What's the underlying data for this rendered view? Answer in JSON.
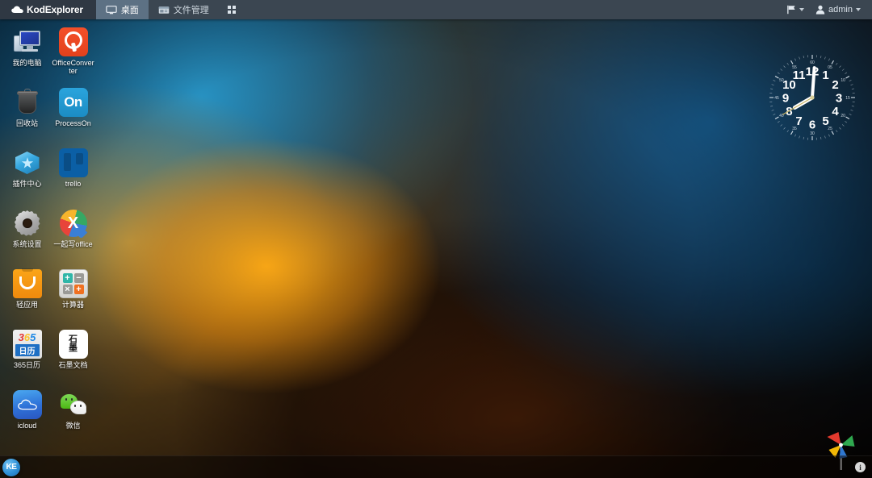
{
  "app": {
    "title": "KodExplorer",
    "logo_icon": "cloud-icon"
  },
  "topbar": {
    "tabs": [
      {
        "label": "桌面",
        "icon": "monitor-icon",
        "active": true
      },
      {
        "label": "文件管理",
        "icon": "folder-window-icon",
        "active": false
      }
    ],
    "grid_icon": "app-grid-icon",
    "right": {
      "flag_icon": "flag-icon",
      "flag_caret": "chevron-down-icon",
      "user_icon": "user-icon",
      "user_label": "admin",
      "user_caret": "chevron-down-icon"
    }
  },
  "desktop": {
    "icons": [
      {
        "label": "我的电脑",
        "art": "mypc",
        "icon": "my-computer-icon"
      },
      {
        "label": "OfficeConverter",
        "art": "officeconv",
        "icon": "officeconverter-icon"
      },
      {
        "label": "回收站",
        "art": "trash",
        "icon": "recycle-bin-icon"
      },
      {
        "label": "ProcessOn",
        "art": "processon",
        "icon": "processon-icon",
        "art_text": "On"
      },
      {
        "label": "插件中心",
        "art": "plugin",
        "icon": "plugin-center-icon"
      },
      {
        "label": "trello",
        "art": "trello",
        "icon": "trello-icon"
      },
      {
        "label": "系统设置",
        "art": "gear",
        "icon": "system-settings-icon"
      },
      {
        "label": "一起写office",
        "art": "yqx",
        "icon": "yiqixie-office-icon",
        "art_text": "X"
      },
      {
        "label": "轻应用",
        "art": "light",
        "icon": "light-apps-icon"
      },
      {
        "label": "计算器",
        "art": "calc",
        "icon": "calculator-icon",
        "calc_keys": [
          "+",
          "−",
          "×",
          "+"
        ]
      },
      {
        "label": "365日历",
        "art": "c365",
        "icon": "calendar-365-icon",
        "c365_top": [
          "3",
          "6",
          "5"
        ],
        "c365_bottom": "日历"
      },
      {
        "label": "石墨文档",
        "art": "shimo",
        "icon": "shimo-docs-icon",
        "shimo_chars": [
          "石",
          "墨"
        ]
      },
      {
        "label": "icloud",
        "art": "icloud",
        "icon": "icloud-icon"
      },
      {
        "label": "微信",
        "art": "wechat",
        "icon": "wechat-icon"
      }
    ]
  },
  "clock": {
    "name": "analog-clock-widget",
    "hours": [
      "12",
      "1",
      "2",
      "3",
      "4",
      "5",
      "6",
      "7",
      "8",
      "9",
      "10",
      "11"
    ],
    "minute_marks": [
      "60",
      "05",
      "10",
      "15",
      "20",
      "25",
      "30",
      "35",
      "40",
      "45",
      "50",
      "55"
    ],
    "time": {
      "hour": 8,
      "minute": 0,
      "second": 40
    },
    "hand_color": "#ffffff",
    "second_hand_color": "#c8b464"
  },
  "pinwheel": {
    "name": "pinwheel-widget",
    "colors": [
      "#e33a2e",
      "#f2b705",
      "#2fa84f",
      "#2f77d0"
    ]
  },
  "taskbar": {
    "start_label": "KE",
    "info_label": "i"
  },
  "colors": {
    "topbar_bg": "#3b4651",
    "topbar_logo_bg": "#2f3843",
    "tab_active_bg": "#5d7184",
    "accent_blue": "#2e8fd6",
    "wallpaper_blue": "#15608f",
    "wallpaper_orange": "#e8900f"
  }
}
